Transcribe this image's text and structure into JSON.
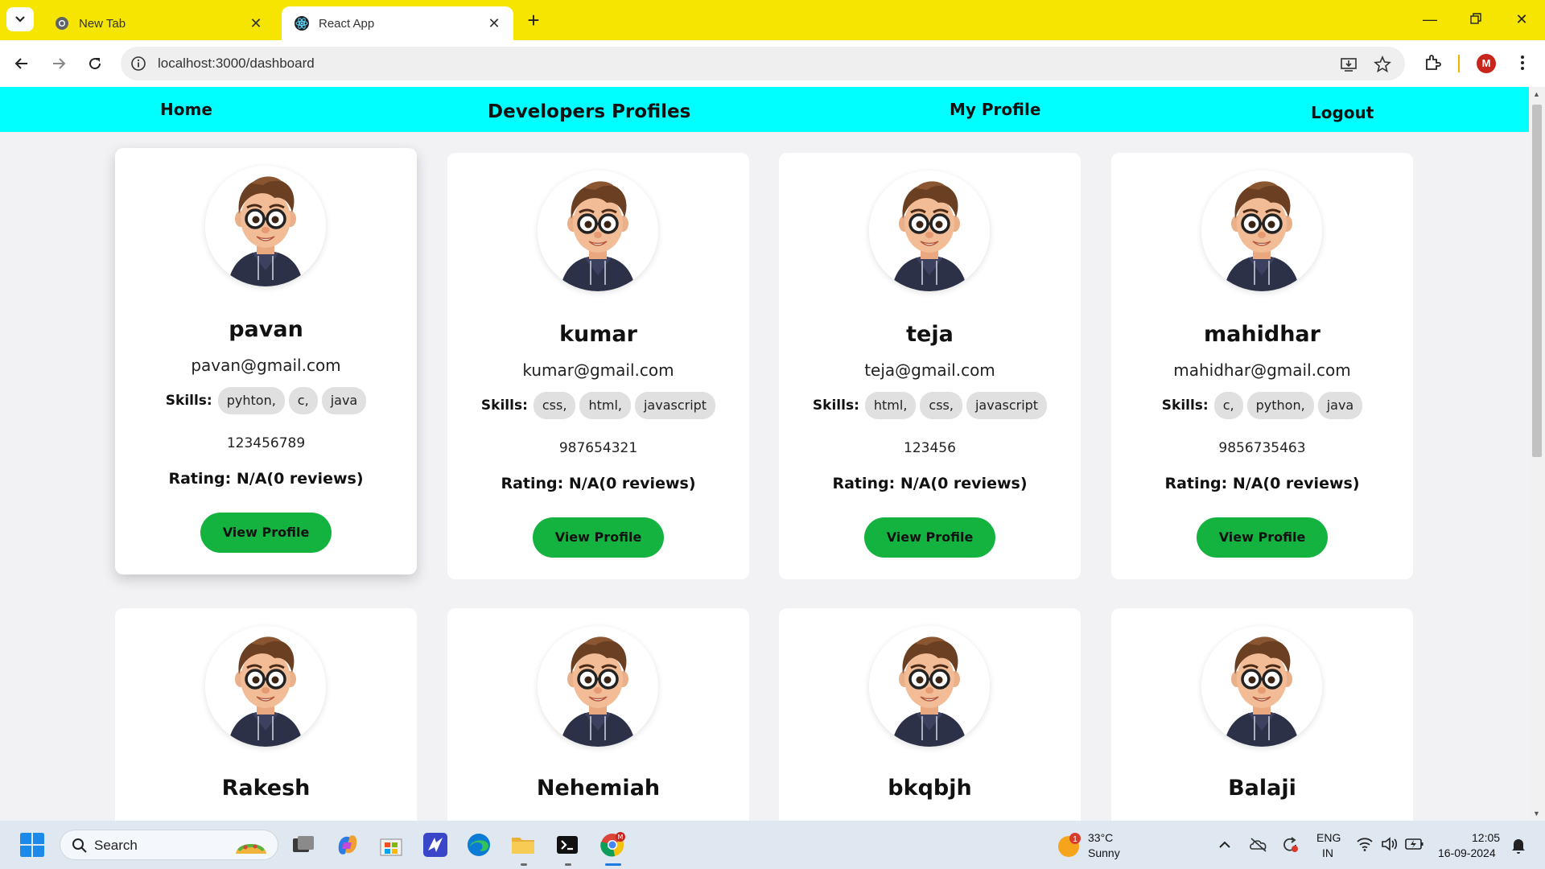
{
  "browser": {
    "tabs": [
      {
        "title": "New Tab",
        "icon": "chrome-icon",
        "active": false
      },
      {
        "title": "React App",
        "icon": "react-icon",
        "active": true
      }
    ],
    "url": "localhost:3000/dashboard",
    "profile_initial": "M"
  },
  "navbar": {
    "home": "Home",
    "developers": "Developers Profiles",
    "my_profile": "My Profile",
    "logout": "Logout",
    "bg_color": "#00ffff"
  },
  "cards": [
    {
      "name": "pavan",
      "email": "pavan@gmail.com",
      "skills_label": "Skills:",
      "skills": [
        "pyhton,",
        "c,",
        "java"
      ],
      "phone": "123456789",
      "rating": "Rating: N/A(0 reviews)",
      "button": "View Profile"
    },
    {
      "name": "kumar",
      "email": "kumar@gmail.com",
      "skills_label": "Skills:",
      "skills": [
        "css,",
        "html,",
        "javascript"
      ],
      "phone": "987654321",
      "rating": "Rating: N/A(0 reviews)",
      "button": "View Profile"
    },
    {
      "name": "teja",
      "email": "teja@gmail.com",
      "skills_label": "Skills:",
      "skills": [
        "html,",
        "css,",
        "javascript"
      ],
      "phone": "123456",
      "rating": "Rating: N/A(0 reviews)",
      "button": "View Profile"
    },
    {
      "name": "mahidhar",
      "email": "mahidhar@gmail.com",
      "skills_label": "Skills:",
      "skills": [
        "c,",
        "python,",
        "java"
      ],
      "phone": "9856735463",
      "rating": "Rating: N/A(0 reviews)",
      "button": "View Profile"
    },
    {
      "name": "Rakesh"
    },
    {
      "name": "Nehemiah"
    },
    {
      "name": "bkqbjh"
    },
    {
      "name": "Balaji"
    }
  ],
  "taskbar": {
    "search_label": "Search",
    "weather_temp": "33°C",
    "weather_desc": "Sunny",
    "weather_badge": "1",
    "lang_top": "ENG",
    "lang_bottom": "IN",
    "time": "12:05",
    "date": "16-09-2024"
  },
  "colors": {
    "tabbar": "#f5e500",
    "view_button": "#14b340",
    "chip": "#e0e0e0"
  }
}
